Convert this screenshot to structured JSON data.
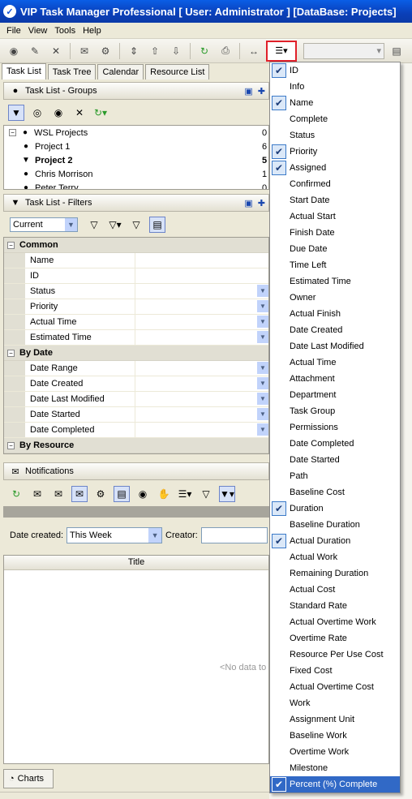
{
  "window": {
    "title": "VIP Task Manager Professional [ User: Administrator ] [DataBase: Projects]"
  },
  "menu": [
    "File",
    "View",
    "Tools",
    "Help"
  ],
  "tabs": [
    "Task List",
    "Task Tree",
    "Calendar",
    "Resource List"
  ],
  "groups_panel": {
    "title": "Task List - Groups",
    "tree": [
      {
        "label": "WSL Projects",
        "count": "0"
      },
      {
        "label": "Project 1",
        "count": "6"
      },
      {
        "label": "Project 2",
        "count": "5"
      },
      {
        "label": "Chris Morrison",
        "count": "1"
      },
      {
        "label": "Peter Terry",
        "count": "0"
      }
    ]
  },
  "filters_panel": {
    "title": "Task List - Filters",
    "current_filter": "Current",
    "categories": [
      {
        "name": "Common",
        "rows": [
          "Name",
          "ID",
          "Status",
          "Priority",
          "Actual Time",
          "Estimated Time"
        ]
      },
      {
        "name": "By Date",
        "rows": [
          "Date Range",
          "Date Created",
          "Date Last Modified",
          "Date Started",
          "Date Completed"
        ]
      },
      {
        "name": "By Resource",
        "rows": []
      }
    ]
  },
  "notifications": {
    "title": "Notifications",
    "date_created_label": "Date created:",
    "date_created_value": "This Week",
    "creator_label": "Creator:",
    "title_column": "Title",
    "no_data": "<No data to d"
  },
  "bottom_tab": "Charts",
  "columns_menu": [
    {
      "label": "ID",
      "checked": true
    },
    {
      "label": "Info",
      "checked": false
    },
    {
      "label": "Name",
      "checked": true
    },
    {
      "label": "Complete",
      "checked": false
    },
    {
      "label": "Status",
      "checked": false
    },
    {
      "label": "Priority",
      "checked": true
    },
    {
      "label": "Assigned",
      "checked": true
    },
    {
      "label": "Confirmed",
      "checked": false
    },
    {
      "label": "Start Date",
      "checked": false
    },
    {
      "label": "Actual Start",
      "checked": false
    },
    {
      "label": "Finish Date",
      "checked": false
    },
    {
      "label": "Due Date",
      "checked": false
    },
    {
      "label": "Time Left",
      "checked": false
    },
    {
      "label": "Estimated Time",
      "checked": false
    },
    {
      "label": "Owner",
      "checked": false
    },
    {
      "label": "Actual Finish",
      "checked": false
    },
    {
      "label": "Date Created",
      "checked": false
    },
    {
      "label": "Date Last Modified",
      "checked": false
    },
    {
      "label": "Actual Time",
      "checked": false
    },
    {
      "label": "Attachment",
      "checked": false
    },
    {
      "label": "Department",
      "checked": false
    },
    {
      "label": "Task Group",
      "checked": false
    },
    {
      "label": "Permissions",
      "checked": false
    },
    {
      "label": "Date Completed",
      "checked": false
    },
    {
      "label": "Date Started",
      "checked": false
    },
    {
      "label": "Path",
      "checked": false
    },
    {
      "label": "Baseline Cost",
      "checked": false
    },
    {
      "label": "Duration",
      "checked": true
    },
    {
      "label": "Baseline Duration",
      "checked": false
    },
    {
      "label": "Actual Duration",
      "checked": true
    },
    {
      "label": "Actual Work",
      "checked": false
    },
    {
      "label": "Remaining Duration",
      "checked": false
    },
    {
      "label": "Actual Cost",
      "checked": false
    },
    {
      "label": "Standard Rate",
      "checked": false
    },
    {
      "label": "Actual Overtime Work",
      "checked": false
    },
    {
      "label": "Overtime Rate",
      "checked": false
    },
    {
      "label": "Resource Per Use Cost",
      "checked": false
    },
    {
      "label": "Fixed Cost",
      "checked": false
    },
    {
      "label": "Actual Overtime Cost",
      "checked": false
    },
    {
      "label": "Work",
      "checked": false
    },
    {
      "label": "Assignment Unit",
      "checked": false
    },
    {
      "label": "Baseline Work",
      "checked": false
    },
    {
      "label": "Overtime Work",
      "checked": false
    },
    {
      "label": "Milestone",
      "checked": false
    },
    {
      "label": "Percent (%) Complete",
      "checked": true,
      "selected": true
    }
  ]
}
